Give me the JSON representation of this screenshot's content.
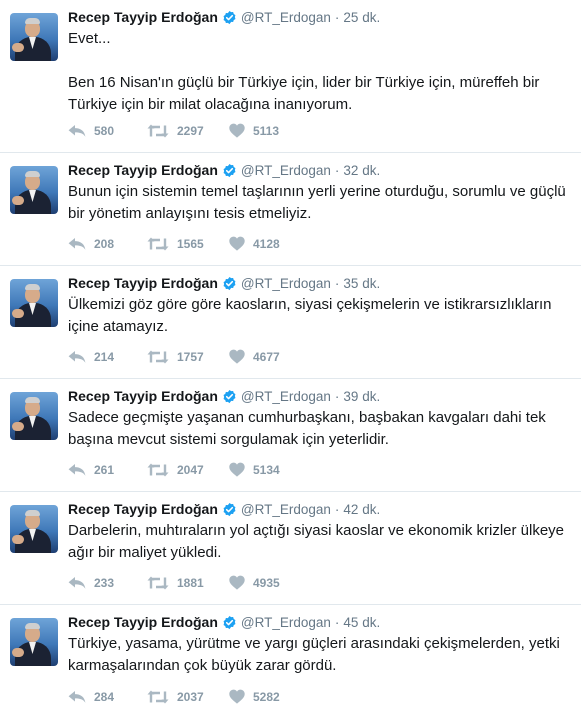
{
  "colors": {
    "verified": "#1da1f2",
    "meta_text": "#657786",
    "action_icon": "#aab8c2",
    "divider": "#e1e8ed"
  },
  "tweets": [
    {
      "name": "Recep Tayyip Erdoğan",
      "handle": "@RT_Erdogan",
      "separator": "·",
      "time": "25 dk.",
      "text": "Evet...\n\nBen 16 Nisan'ın güçlü bir Türkiye için, lider bir Türkiye için, müreffeh bir Türkiye için bir milat olacağına inanıyorum.",
      "replies": "580",
      "retweets": "2297",
      "likes": "5113"
    },
    {
      "name": "Recep Tayyip Erdoğan",
      "handle": "@RT_Erdogan",
      "separator": "·",
      "time": "32 dk.",
      "text": "Bunun için sistemin temel taşlarının yerli yerine oturduğu, sorumlu ve güçlü bir yönetim anlayışını tesis etmeliyiz.",
      "replies": "208",
      "retweets": "1565",
      "likes": "4128"
    },
    {
      "name": "Recep Tayyip Erdoğan",
      "handle": "@RT_Erdogan",
      "separator": "·",
      "time": "35 dk.",
      "text": "Ülkemizi göz göre göre kaosların, siyasi çekişmelerin ve istikrarsızlıkların içine atamayız.",
      "replies": "214",
      "retweets": "1757",
      "likes": "4677"
    },
    {
      "name": "Recep Tayyip Erdoğan",
      "handle": "@RT_Erdogan",
      "separator": "·",
      "time": "39 dk.",
      "text": "Sadece geçmişte yaşanan cumhurbaşkanı, başbakan kavgaları dahi tek başına mevcut sistemi sorgulamak için yeterlidir.",
      "replies": "261",
      "retweets": "2047",
      "likes": "5134"
    },
    {
      "name": "Recep Tayyip Erdoğan",
      "handle": "@RT_Erdogan",
      "separator": "·",
      "time": "42 dk.",
      "text": "Darbelerin, muhtıraların yol açtığı siyasi kaoslar ve ekonomik krizler ülkeye ağır bir maliyet yükledi.",
      "replies": "233",
      "retweets": "1881",
      "likes": "4935"
    },
    {
      "name": "Recep Tayyip Erdoğan",
      "handle": "@RT_Erdogan",
      "separator": "·",
      "time": "45 dk.",
      "text": "Türkiye, yasama, yürütme ve yargı güçleri arasındaki çekişmelerden, yetki karmaşalarından çok büyük zarar gördü.",
      "replies": "284",
      "retweets": "2037",
      "likes": "5282"
    }
  ]
}
